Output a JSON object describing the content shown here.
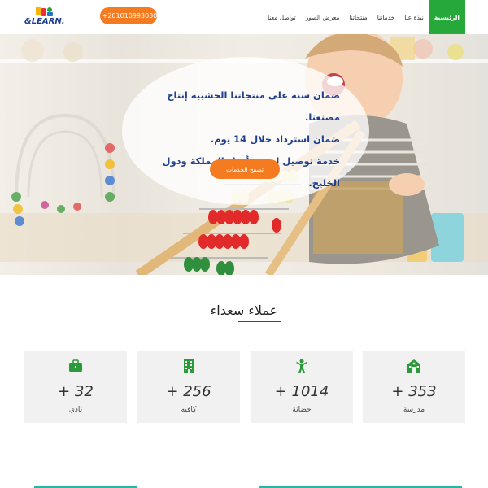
{
  "header": {
    "logo_text": "&LEARN.",
    "phone_label": "+201010993030",
    "nav": [
      {
        "label": "الرئيسية",
        "active": true
      },
      {
        "label": "نبذة عنا",
        "active": false
      },
      {
        "label": "خدماتنا",
        "active": false
      },
      {
        "label": "منتجاتنا",
        "active": false
      },
      {
        "label": "معرض الصور",
        "active": false
      },
      {
        "label": "تواصل معنا",
        "active": false
      }
    ]
  },
  "hero": {
    "lines": [
      "ضمان سنة على منتجاتنا الخشبية إنتاج مصنعنا.",
      "ضمان استرداد خلال 14 يوم.",
      "خدمة توصيل لجميع أنحاء المملكة ودول الخليج."
    ],
    "button_label": "تصفح الخدمات"
  },
  "clients": {
    "title": "عملاء سعداء",
    "cards": [
      {
        "value": "+ 353",
        "label": "مدرسة",
        "icon": "school-icon"
      },
      {
        "value": "+ 1014",
        "label": "حضانة",
        "icon": "child-icon"
      },
      {
        "value": "+ 256",
        "label": "كافيه",
        "icon": "building-icon"
      },
      {
        "value": "+ 32",
        "label": "نادي",
        "icon": "briefcase-icon"
      }
    ]
  },
  "colors": {
    "accent_orange": "#f47b20",
    "accent_green": "#26a83a",
    "hero_text": "#1d3f8e",
    "teal": "#2bb5a3"
  }
}
